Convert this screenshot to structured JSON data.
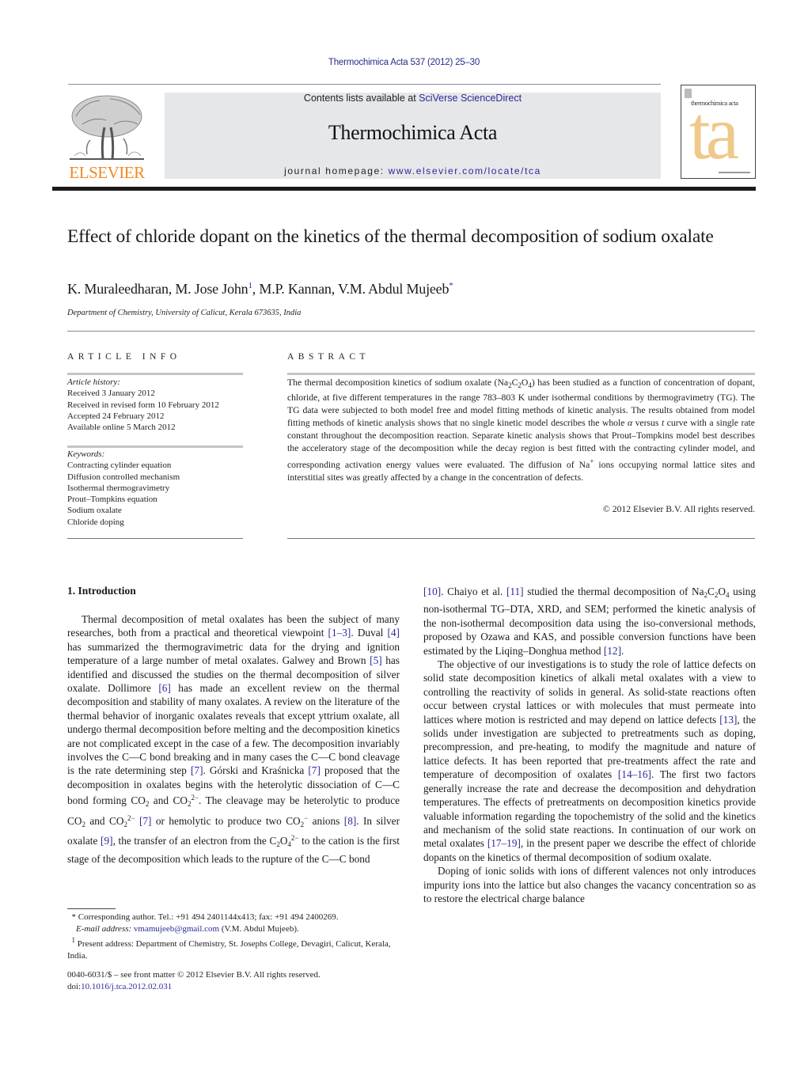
{
  "header": {
    "citation": "Thermochimica Acta 537 (2012) 25–30",
    "contents_prefix": "Contents lists available at ",
    "contents_link": "SciVerse ScienceDirect",
    "journal_title": "Thermochimica Acta",
    "homepage_prefix": "journal homepage: ",
    "homepage_link": "www.elsevier.com/locate/tca",
    "publisher_logo_text": "ELSEVIER",
    "cover_title": "thermochimica acta",
    "cover_monogram": "ta",
    "colors": {
      "publisher_orange": "#f08a24",
      "link_blue": "#2a2a9a",
      "panel_grey": "#e6e7e9",
      "cover_tan": "#efc88a"
    }
  },
  "article": {
    "title": "Effect of chloride dopant on the kinetics of the thermal decomposition of sodium oxalate",
    "authors": [
      {
        "name": "K. Muraleedharan",
        "mark": ""
      },
      {
        "name": "M. Jose John",
        "mark": "1"
      },
      {
        "name": "M.P. Kannan",
        "mark": ""
      },
      {
        "name": "V.M. Abdul Mujeeb",
        "mark": "*"
      }
    ],
    "affiliation": "Department of Chemistry, University of Calicut, Kerala 673635, India"
  },
  "article_info": {
    "label": "ARTICLE INFO",
    "history_label": "Article history:",
    "history": [
      "Received 3 January 2012",
      "Received in revised form 10 February 2012",
      "Accepted 24 February 2012",
      "Available online 5 March 2012"
    ],
    "keywords_label": "Keywords:",
    "keywords": [
      "Contracting cylinder equation",
      "Diffusion controlled mechanism",
      "Isothermal thermogravimetry",
      "Prout–Tompkins equation",
      "Sodium oxalate",
      "Chloride doping"
    ]
  },
  "abstract": {
    "label": "ABSTRACT",
    "t1": "The thermal decomposition kinetics of sodium oxalate (Na",
    "t2": "C",
    "t3": "O",
    "t4": ") has been studied as a function of concentration of dopant, chloride, at five different temperatures in the range 783–803 K under isothermal conditions by thermogravimetry (TG). The TG data were subjected to both model free and model fitting methods of kinetic analysis. The results obtained from model fitting methods of kinetic analysis shows that no single kinetic model describes the whole ",
    "alpha": "α",
    "t5": " versus ",
    "t_var": "t",
    "t6": " curve with a single rate constant throughout the decomposition reaction. Separate kinetic analysis shows that Prout–Tompkins model best describes the acceleratory stage of the decomposition while the decay region is best fitted with the contracting cylinder model, and corresponding activation energy values were evaluated. The diffusion of Na",
    "plus": "+",
    "t7": " ions occupying normal lattice sites and interstitial sites was greatly affected by a change in the concentration of defects.",
    "copyright": "© 2012 Elsevier B.V. All rights reserved."
  },
  "body": {
    "section_heading": "1.  Introduction",
    "sub2": "2",
    "sub4": "4",
    "sup2m": "2−",
    "supm": "−",
    "p1": {
      "a": "Thermal decomposition of metal oxalates has been the subject of many researches, both from a practical and theoretical viewpoint ",
      "c1": "[1–3]",
      "b": ". Duval ",
      "c2": "[4]",
      "c": " has summarized the thermogravimetric data for the drying and ignition temperature of a large number of metal oxalates. Galwey and Brown ",
      "c3": "[5]",
      "d": " has identified and discussed the studies on the thermal decomposition of silver oxalate. Dollimore ",
      "c4": "[6]",
      "e": " has made an excellent review on the thermal decomposition and stability of many oxalates. A review on the literature of the thermal behavior of inorganic oxalates reveals that except yttrium oxalate, all undergo thermal decomposition before melting and the decomposition kinetics are not complicated except in the case of a few. The decomposition invariably involves the C—C bond breaking and in many cases the C—C bond cleavage is the rate determining step ",
      "c5": "[7]",
      "f": ". Górski and Kraśnicka ",
      "c6": "[7]",
      "g": " proposed that the decomposition in oxalates begins with the heterolytic dissociation of C—C bond forming CO",
      "h": " and CO",
      "i": ". The cleavage may be heterolytic to produce CO",
      "j": " and CO",
      "c7": "[7]",
      "k": " or hemolytic to produce two CO",
      "l": " anions ",
      "c8": "[8]",
      "m": ". In silver oxalate ",
      "c9": "[9]",
      "n": ", the transfer of an electron from the C",
      "o": "O",
      "p": " to the cation is the first stage of the decomposition which leads to the rupture of the C—C bond ",
      "c10": "[10]",
      "q": ". Chaiyo et al. ",
      "c11": "[11]",
      "r": " studied the thermal decomposition of Na",
      "s": "C",
      "t": "O",
      "u": " using non-isothermal TG–DTA, XRD, and SEM; performed the kinetic analysis of the non-isothermal decomposition data using the iso-conversional methods, proposed by Ozawa and KAS, and possible conversion functions have been estimated by the Liqing–Donghua method ",
      "c12": "[12]",
      "v": "."
    },
    "p2": {
      "a": "The objective of our investigations is to study the role of lattice defects on solid state decomposition kinetics of alkali metal oxalates with a view to controlling the reactivity of solids in general. As solid-state reactions often occur between crystal lattices or with molecules that must permeate into lattices where motion is restricted and may depend on lattice defects ",
      "c13": "[13]",
      "b": ", the solids under investigation are subjected to pretreatments such as doping, precompression, and pre-heating, to modify the magnitude and nature of lattice defects. It has been reported that pre-treatments affect the rate and temperature of decomposition of oxalates ",
      "c14": "[14–16]",
      "c": ". The first two factors generally increase the rate and decrease the decomposition and dehydration temperatures. The effects of pretreatments on decomposition kinetics provide valuable information regarding the topochemistry of the solid and the kinetics and mechanism of the solid state reactions. In continuation of our work on metal oxalates ",
      "c17": "[17–19]",
      "d": ", in the present paper we describe the effect of chloride dopants on the kinetics of thermal decomposition of sodium oxalate."
    },
    "p3": "Doping of ionic solids with ions of different valences not only introduces impurity ions into the lattice but also changes the vacancy concentration so as to restore the electrical charge balance"
  },
  "footnotes": {
    "corr_mark": "*",
    "corr_text": " Corresponding author. Tel.: +91 494 2401144x413; fax: +91 494 2400269.",
    "email_label": "E-mail address: ",
    "email": "vmamujeeb@gmail.com",
    "email_suffix": " (V.M. Abdul Mujeeb).",
    "addr_mark": "1",
    "addr_text": " Present address: Department of Chemistry, St. Josephs College, Devagiri, Calicut, Kerala, India.",
    "frontmatter": "0040-6031/$ – see front matter © 2012 Elsevier B.V. All rights reserved.",
    "doi_prefix": "doi:",
    "doi": "10.1016/j.tca.2012.02.031"
  }
}
